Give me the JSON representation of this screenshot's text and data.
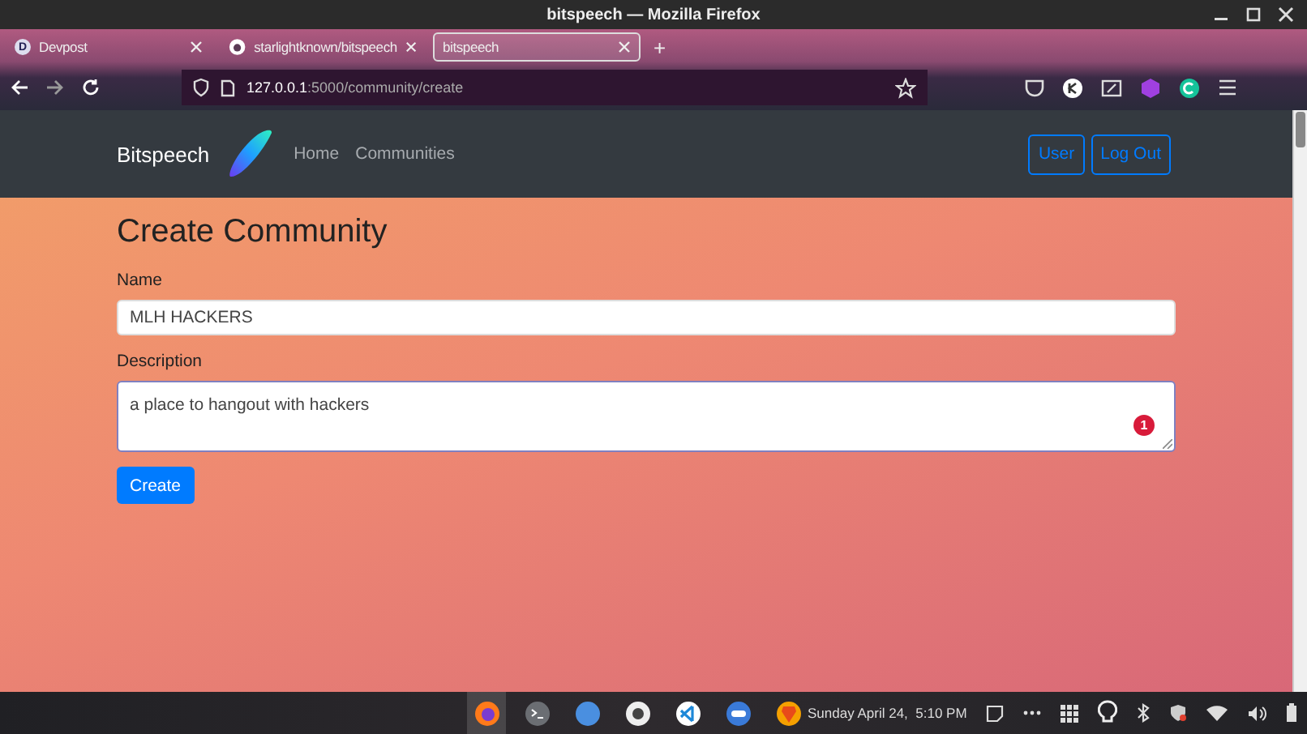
{
  "window": {
    "title": "bitspeech — Mozilla Firefox"
  },
  "tabs": [
    {
      "label": "Devpost",
      "kind": "letter",
      "icon_text": "D",
      "selected": false
    },
    {
      "label": "starlightknown/bitspeech",
      "kind": "github",
      "selected": false
    },
    {
      "label": "bitspeech",
      "kind": "plain",
      "selected": true
    }
  ],
  "new_tab": "+",
  "address_bar": {
    "host": "127.0.0.1",
    "path": ":5000/community/create"
  },
  "site": {
    "brand": "Bitspeech",
    "nav": [
      {
        "label": "Home"
      },
      {
        "label": "Communities"
      }
    ],
    "account_buttons": [
      {
        "label": "User"
      },
      {
        "label": "Log Out"
      }
    ]
  },
  "form": {
    "heading": "Create Community",
    "fields": [
      {
        "kind": "input",
        "label": "Name",
        "value": "MLH HACKERS"
      },
      {
        "kind": "textarea",
        "label": "Description",
        "value": "a place to hangout with hackers",
        "badge": "1"
      }
    ],
    "submit": "Create"
  },
  "taskbar": {
    "apps": [
      {
        "kind": "firefox",
        "selected": true
      },
      {
        "kind": "terminal",
        "selected": false
      },
      {
        "kind": "files",
        "selected": false
      },
      {
        "kind": "disc",
        "selected": false
      },
      {
        "kind": "vscode",
        "selected": false
      },
      {
        "kind": "toggle",
        "selected": false
      },
      {
        "kind": "brave",
        "selected": false
      }
    ],
    "clock": "Sunday April 24,  5:10 PM"
  }
}
